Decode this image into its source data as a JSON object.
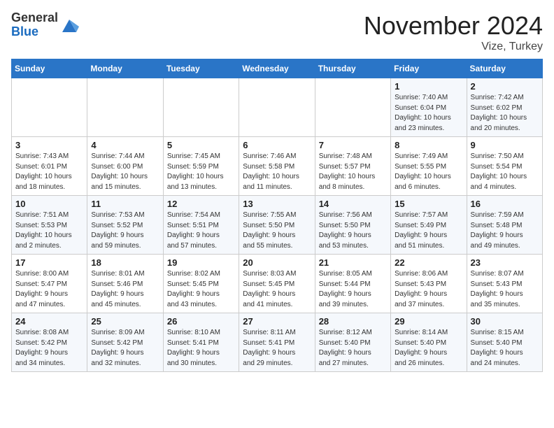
{
  "logo": {
    "general": "General",
    "blue": "Blue"
  },
  "header": {
    "month": "November 2024",
    "location": "Vize, Turkey"
  },
  "days_of_week": [
    "Sunday",
    "Monday",
    "Tuesday",
    "Wednesday",
    "Thursday",
    "Friday",
    "Saturday"
  ],
  "weeks": [
    [
      {
        "day": "",
        "info": ""
      },
      {
        "day": "",
        "info": ""
      },
      {
        "day": "",
        "info": ""
      },
      {
        "day": "",
        "info": ""
      },
      {
        "day": "",
        "info": ""
      },
      {
        "day": "1",
        "info": "Sunrise: 7:40 AM\nSunset: 6:04 PM\nDaylight: 10 hours\nand 23 minutes."
      },
      {
        "day": "2",
        "info": "Sunrise: 7:42 AM\nSunset: 6:02 PM\nDaylight: 10 hours\nand 20 minutes."
      }
    ],
    [
      {
        "day": "3",
        "info": "Sunrise: 7:43 AM\nSunset: 6:01 PM\nDaylight: 10 hours\nand 18 minutes."
      },
      {
        "day": "4",
        "info": "Sunrise: 7:44 AM\nSunset: 6:00 PM\nDaylight: 10 hours\nand 15 minutes."
      },
      {
        "day": "5",
        "info": "Sunrise: 7:45 AM\nSunset: 5:59 PM\nDaylight: 10 hours\nand 13 minutes."
      },
      {
        "day": "6",
        "info": "Sunrise: 7:46 AM\nSunset: 5:58 PM\nDaylight: 10 hours\nand 11 minutes."
      },
      {
        "day": "7",
        "info": "Sunrise: 7:48 AM\nSunset: 5:57 PM\nDaylight: 10 hours\nand 8 minutes."
      },
      {
        "day": "8",
        "info": "Sunrise: 7:49 AM\nSunset: 5:55 PM\nDaylight: 10 hours\nand 6 minutes."
      },
      {
        "day": "9",
        "info": "Sunrise: 7:50 AM\nSunset: 5:54 PM\nDaylight: 10 hours\nand 4 minutes."
      }
    ],
    [
      {
        "day": "10",
        "info": "Sunrise: 7:51 AM\nSunset: 5:53 PM\nDaylight: 10 hours\nand 2 minutes."
      },
      {
        "day": "11",
        "info": "Sunrise: 7:53 AM\nSunset: 5:52 PM\nDaylight: 9 hours\nand 59 minutes."
      },
      {
        "day": "12",
        "info": "Sunrise: 7:54 AM\nSunset: 5:51 PM\nDaylight: 9 hours\nand 57 minutes."
      },
      {
        "day": "13",
        "info": "Sunrise: 7:55 AM\nSunset: 5:50 PM\nDaylight: 9 hours\nand 55 minutes."
      },
      {
        "day": "14",
        "info": "Sunrise: 7:56 AM\nSunset: 5:50 PM\nDaylight: 9 hours\nand 53 minutes."
      },
      {
        "day": "15",
        "info": "Sunrise: 7:57 AM\nSunset: 5:49 PM\nDaylight: 9 hours\nand 51 minutes."
      },
      {
        "day": "16",
        "info": "Sunrise: 7:59 AM\nSunset: 5:48 PM\nDaylight: 9 hours\nand 49 minutes."
      }
    ],
    [
      {
        "day": "17",
        "info": "Sunrise: 8:00 AM\nSunset: 5:47 PM\nDaylight: 9 hours\nand 47 minutes."
      },
      {
        "day": "18",
        "info": "Sunrise: 8:01 AM\nSunset: 5:46 PM\nDaylight: 9 hours\nand 45 minutes."
      },
      {
        "day": "19",
        "info": "Sunrise: 8:02 AM\nSunset: 5:45 PM\nDaylight: 9 hours\nand 43 minutes."
      },
      {
        "day": "20",
        "info": "Sunrise: 8:03 AM\nSunset: 5:45 PM\nDaylight: 9 hours\nand 41 minutes."
      },
      {
        "day": "21",
        "info": "Sunrise: 8:05 AM\nSunset: 5:44 PM\nDaylight: 9 hours\nand 39 minutes."
      },
      {
        "day": "22",
        "info": "Sunrise: 8:06 AM\nSunset: 5:43 PM\nDaylight: 9 hours\nand 37 minutes."
      },
      {
        "day": "23",
        "info": "Sunrise: 8:07 AM\nSunset: 5:43 PM\nDaylight: 9 hours\nand 35 minutes."
      }
    ],
    [
      {
        "day": "24",
        "info": "Sunrise: 8:08 AM\nSunset: 5:42 PM\nDaylight: 9 hours\nand 34 minutes."
      },
      {
        "day": "25",
        "info": "Sunrise: 8:09 AM\nSunset: 5:42 PM\nDaylight: 9 hours\nand 32 minutes."
      },
      {
        "day": "26",
        "info": "Sunrise: 8:10 AM\nSunset: 5:41 PM\nDaylight: 9 hours\nand 30 minutes."
      },
      {
        "day": "27",
        "info": "Sunrise: 8:11 AM\nSunset: 5:41 PM\nDaylight: 9 hours\nand 29 minutes."
      },
      {
        "day": "28",
        "info": "Sunrise: 8:12 AM\nSunset: 5:40 PM\nDaylight: 9 hours\nand 27 minutes."
      },
      {
        "day": "29",
        "info": "Sunrise: 8:14 AM\nSunset: 5:40 PM\nDaylight: 9 hours\nand 26 minutes."
      },
      {
        "day": "30",
        "info": "Sunrise: 8:15 AM\nSunset: 5:40 PM\nDaylight: 9 hours\nand 24 minutes."
      }
    ]
  ]
}
